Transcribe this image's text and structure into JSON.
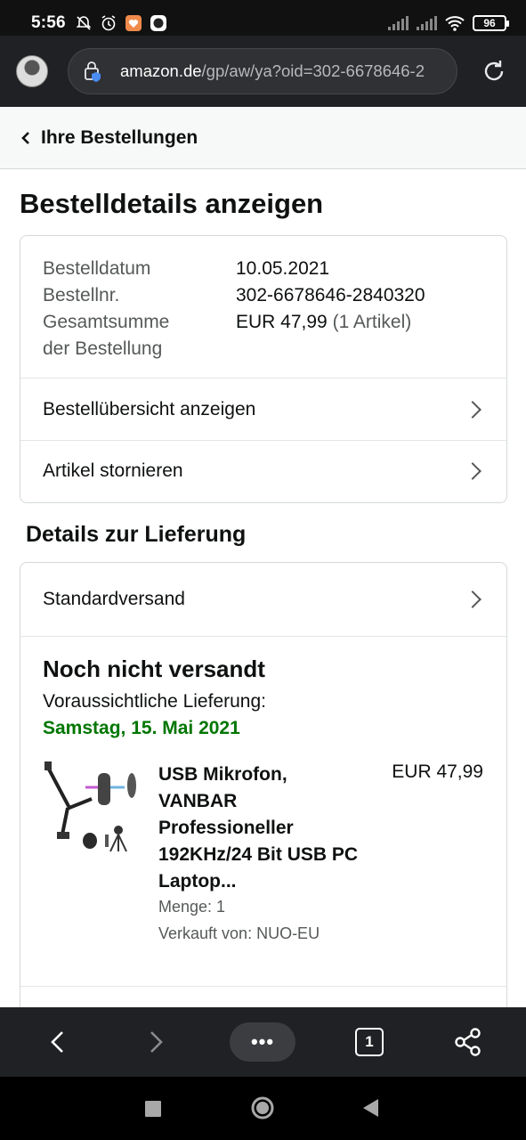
{
  "status_bar": {
    "time": "5:56",
    "battery": "96",
    "icons": [
      "mute-bell-icon",
      "alarm-icon",
      "app-icon",
      "app-icon-2",
      "signal-icon",
      "signal-icon-2",
      "wifi-icon",
      "battery-icon"
    ]
  },
  "browser": {
    "url_host": "amazon.de",
    "url_path": "/gp/aw/ya?oid=302-6678646-2",
    "tab_count": "1",
    "more_label": "•••"
  },
  "breadcrumb": {
    "label": "Ihre Bestellungen"
  },
  "page_title": "Bestelldetails anzeigen",
  "order": {
    "date_label": "Bestelldatum",
    "date_value": "10.05.2021",
    "number_label": "Bestellnr.",
    "number_value": "302-6678646-2840320",
    "total_label_1": "Gesamtsumme",
    "total_label_2": "der Bestellung",
    "total_value": "EUR 47,99",
    "total_items": "(1 Artikel)",
    "links": [
      "Bestellübersicht anzeigen",
      "Artikel stornieren"
    ]
  },
  "delivery": {
    "section_title": "Details zur Lieferung",
    "shipping_method": "Standardversand",
    "status": "Noch nicht versandt",
    "eta_label": "Voraussichtliche Lieferung:",
    "eta_date": "Samstag, 15. Mai 2021",
    "eta_color": "#007600",
    "product": {
      "title": "USB Mikrofon, VANBAR Professioneller 192KHz/24 Bit USB PC Laptop...",
      "price": "EUR 47,99",
      "quantity": "Menge: 1",
      "seller": "Verkauft von: NUO-EU"
    }
  }
}
